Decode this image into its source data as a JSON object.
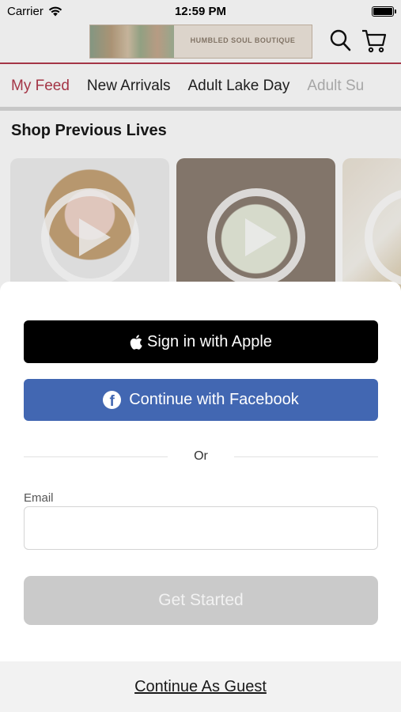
{
  "status_bar": {
    "carrier": "Carrier",
    "time": "12:59 PM"
  },
  "header": {
    "banner_title": "HUMBLED SOUL BOUTIQUE",
    "banner_subtitle": ""
  },
  "tabs": [
    {
      "label": "My Feed",
      "active": true
    },
    {
      "label": "New Arrivals"
    },
    {
      "label": "Adult Lake Day"
    },
    {
      "label": "Adult Su"
    }
  ],
  "section_title": "Shop Previous Lives",
  "sheet": {
    "apple_label": "Sign in with Apple",
    "facebook_label": "Continue with Facebook",
    "or_label": "Or",
    "email_label": "Email",
    "email_value": "",
    "get_started_label": "Get Started",
    "guest_label": "Continue As Guest"
  },
  "colors": {
    "accent": "#b23a4c",
    "facebook": "#4267b2",
    "apple": "#000000",
    "disabled": "#cacaca"
  }
}
